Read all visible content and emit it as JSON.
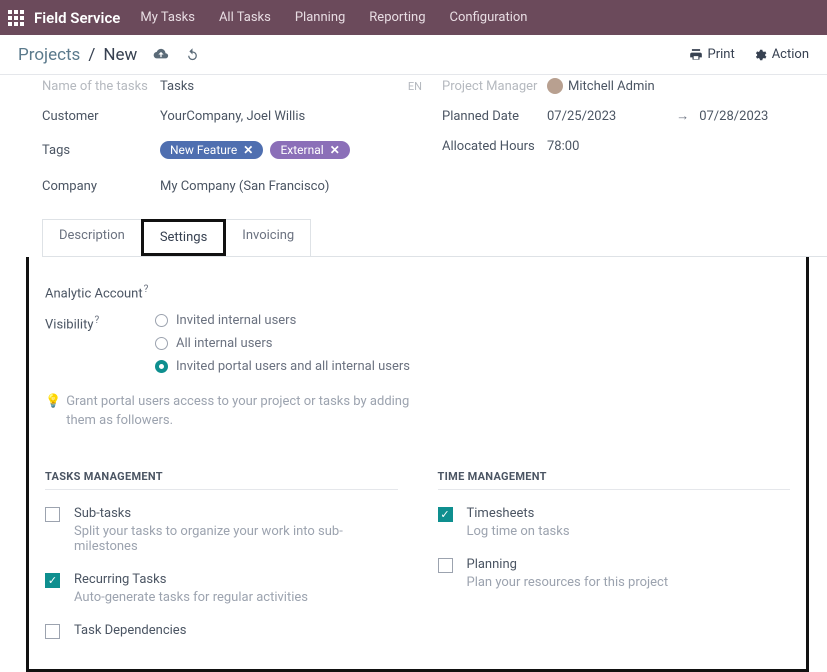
{
  "topbar": {
    "brand": "Field Service",
    "nav": [
      "My Tasks",
      "All Tasks",
      "Planning",
      "Reporting",
      "Configuration"
    ]
  },
  "subhead": {
    "bc_root": "Projects",
    "bc_current": "New",
    "print": "Print",
    "action": "Action"
  },
  "form": {
    "name_label": "Name of the tasks",
    "name_value": "Tasks",
    "lang": "EN",
    "customer_label": "Customer",
    "customer_value": "YourCompany, Joel Willis",
    "tags_label": "Tags",
    "tag1": "New Feature",
    "tag2": "External",
    "company_label": "Company",
    "company_value": "My Company (San Francisco)",
    "pm_label": "Project Manager",
    "pm_value": "Mitchell Admin",
    "planned_label": "Planned Date",
    "planned_start": "07/25/2023",
    "planned_end": "07/28/2023",
    "alloc_label": "Allocated Hours",
    "alloc_value": "78:00"
  },
  "tabs": {
    "description": "Description",
    "settings": "Settings",
    "invoicing": "Invoicing"
  },
  "settings": {
    "analytic_label": "Analytic Account",
    "visibility_label": "Visibility",
    "vis1": "Invited internal users",
    "vis2": "All internal users",
    "vis3": "Invited portal users and all internal users",
    "hint": "Grant portal users access to your project or tasks by adding them as followers.",
    "tasks_mgmt": "TASKS MANAGEMENT",
    "time_mgmt": "TIME MANAGEMENT",
    "subtasks_t": "Sub-tasks",
    "subtasks_d": "Split your tasks to organize your work into sub-milestones",
    "recurring_t": "Recurring Tasks",
    "recurring_d": "Auto-generate tasks for regular activities",
    "taskdep_t": "Task Dependencies",
    "timesheets_t": "Timesheets",
    "timesheets_d": "Log time on tasks",
    "planning_t": "Planning",
    "planning_d": "Plan your resources for this project"
  }
}
